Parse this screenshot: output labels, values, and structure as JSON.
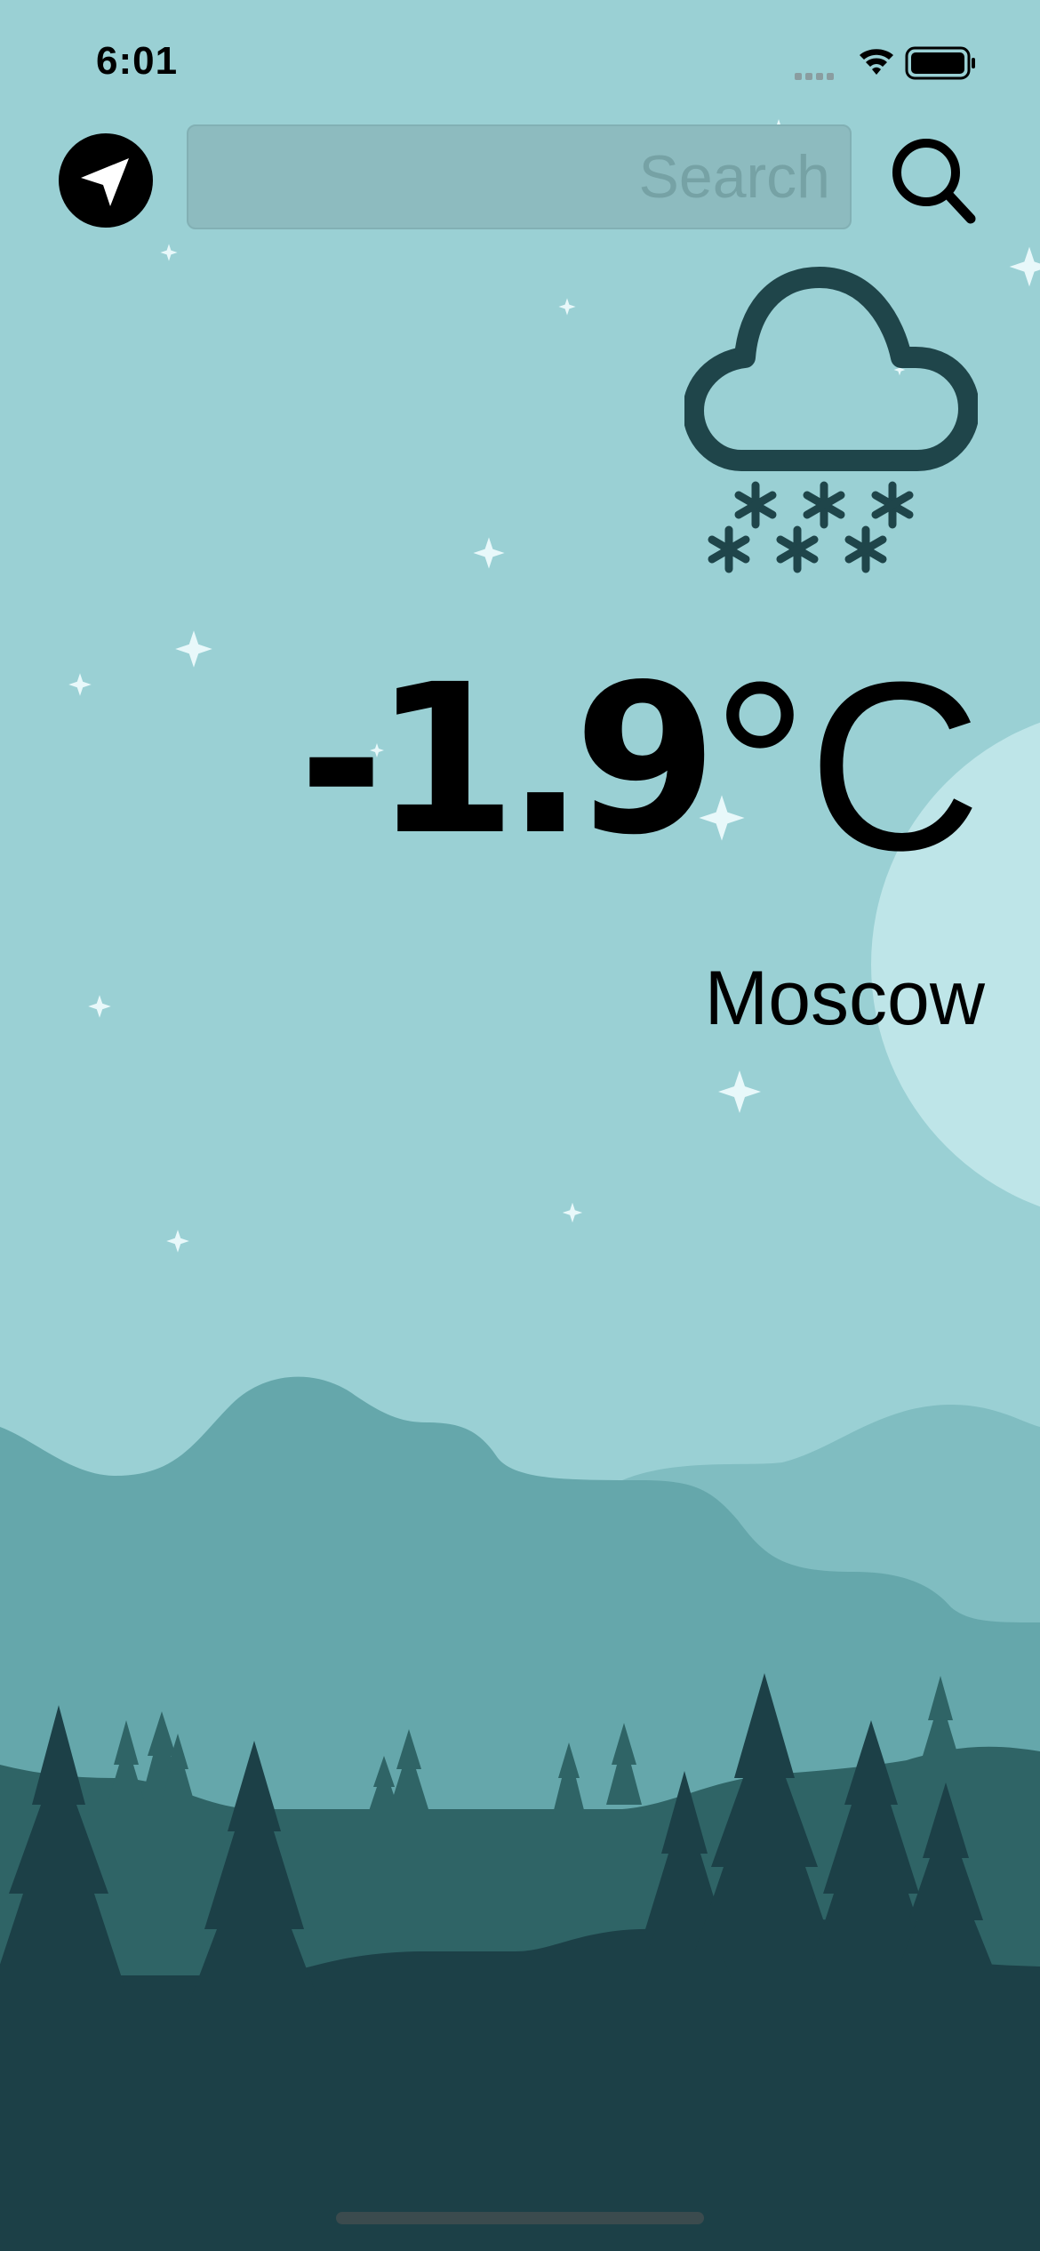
{
  "status_bar": {
    "time": "6:01"
  },
  "search": {
    "placeholder": "Search",
    "value": ""
  },
  "weather": {
    "condition_icon": "snow-cloud-icon",
    "temperature": "-1.9",
    "unit": "°C",
    "city": "Moscow"
  },
  "colors": {
    "sky": "#9ad0d4",
    "moon": "#bee5e8",
    "far_hills": "#80bdc1",
    "mid_hills": "#65a7ab",
    "forest_hills": "#2f6466",
    "foreground": "#1c4047",
    "icon_dark": "#1f454a",
    "star": "#e8f8fa"
  }
}
